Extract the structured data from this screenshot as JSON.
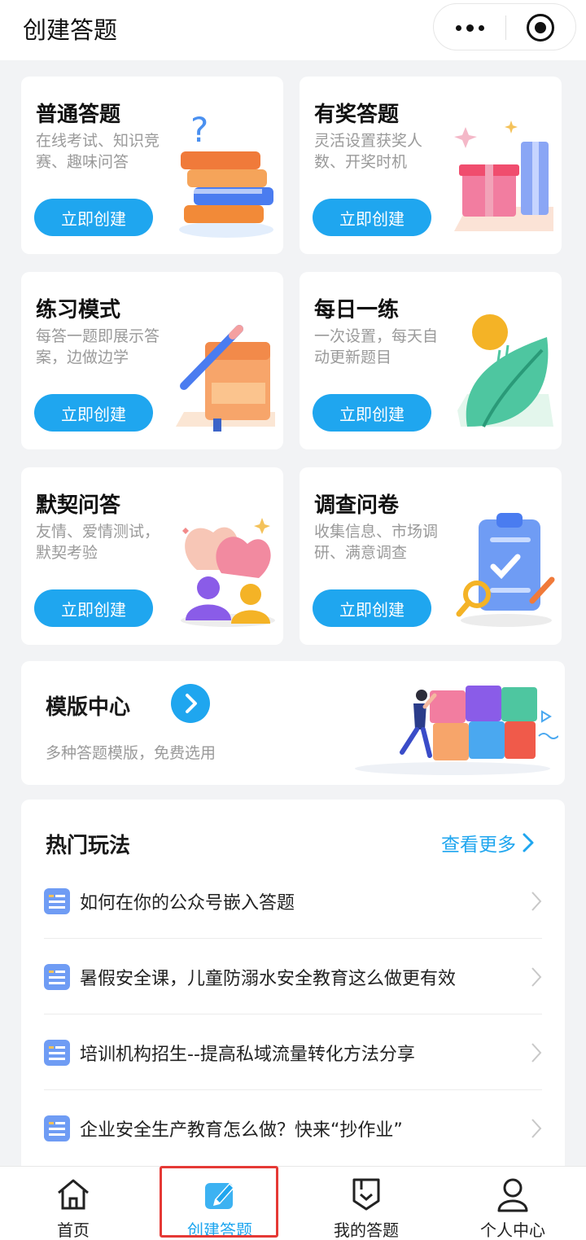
{
  "header": {
    "title": "创建答题"
  },
  "cards": [
    {
      "title": "普通答题",
      "desc": "在线考试、知识竞赛、趣味问答",
      "button": "立即创建",
      "icon": "books-question-icon"
    },
    {
      "title": "有奖答题",
      "desc": "灵活设置获奖人数、开奖时机",
      "button": "立即创建",
      "icon": "gift-box-icon"
    },
    {
      "title": "练习模式",
      "desc": "每答一题即展示答案，边做边学",
      "button": "立即创建",
      "icon": "notebook-pencil-icon"
    },
    {
      "title": "每日一练",
      "desc": "一次设置，每天自动更新题目",
      "button": "立即创建",
      "icon": "sun-leaf-icon"
    },
    {
      "title": "默契问答",
      "desc": "友情、爱情测试，默契考验",
      "button": "立即创建",
      "icon": "hearts-people-icon"
    },
    {
      "title": "调查问卷",
      "desc": "收集信息、市场调研、满意调查",
      "button": "立即创建",
      "icon": "clipboard-magnifier-icon"
    }
  ],
  "template_center": {
    "title": "模版中心",
    "desc": "多种答题模版，免费选用"
  },
  "hot": {
    "title": "热门玩法",
    "more": "查看更多",
    "items": [
      "如何在你的公众号嵌入答题",
      "暑假安全课，儿童防溺水安全教育这么做更有效",
      "培训机构招生--提高私域流量转化方法分享",
      "企业安全生产教育怎么做？快来“抄作业”"
    ]
  },
  "tabs": [
    {
      "label": "首页",
      "icon": "home-icon"
    },
    {
      "label": "创建答题",
      "icon": "edit-icon"
    },
    {
      "label": "我的答题",
      "icon": "badge-icon"
    },
    {
      "label": "个人中心",
      "icon": "user-icon"
    }
  ],
  "colors": {
    "accent": "#1fa6ef",
    "highlight": "#e53935",
    "background": "#f2f3f5"
  }
}
